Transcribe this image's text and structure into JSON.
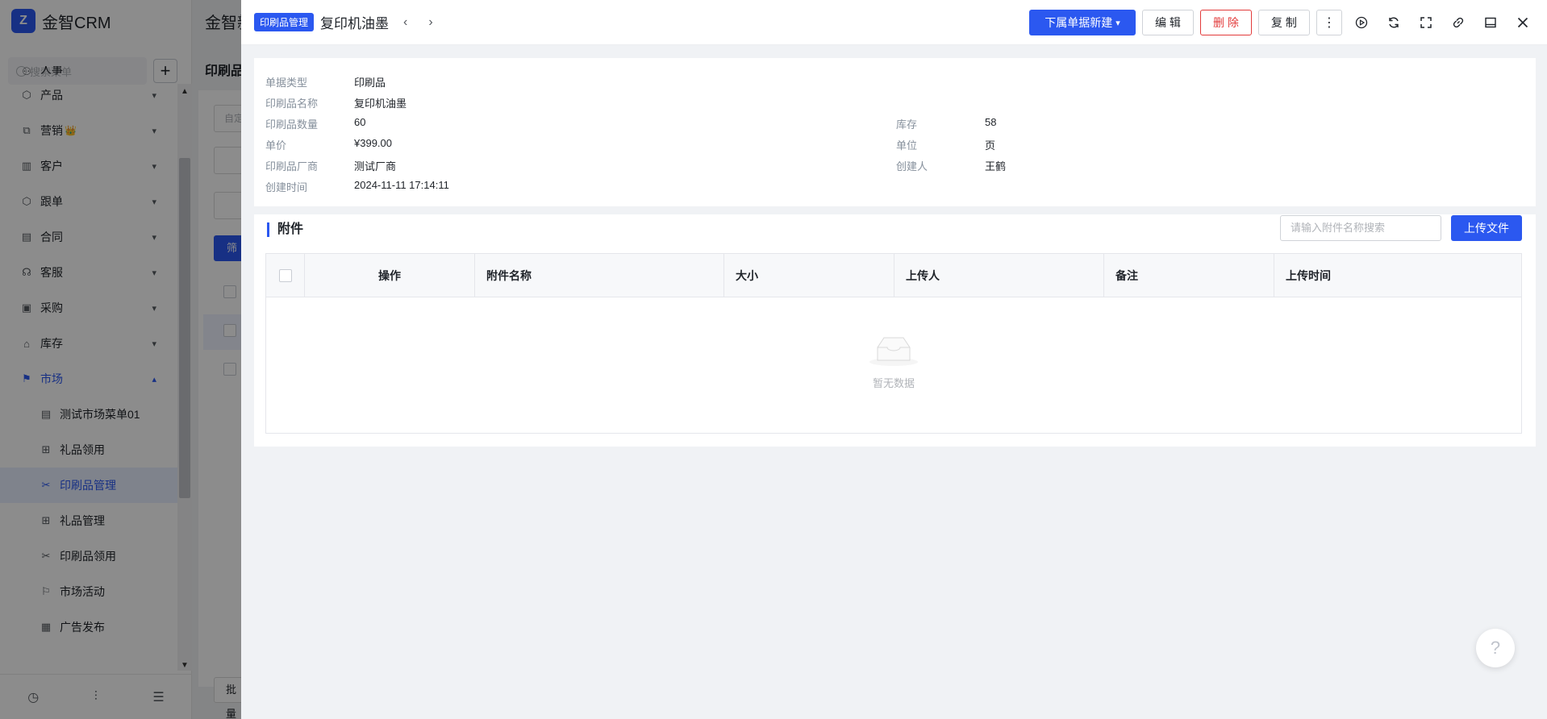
{
  "app": {
    "logo_glyph": "Z",
    "name": "金智CRM",
    "search_placeholder": "搜索菜单",
    "add_symbol": "+"
  },
  "sidebar": {
    "partial_top_item": "人事",
    "groups": [
      {
        "label": "产品",
        "icon": "product-icon"
      },
      {
        "label": "营销",
        "icon": "marketing-icon",
        "crown": "👑"
      },
      {
        "label": "客户",
        "icon": "customer-icon"
      },
      {
        "label": "跟单",
        "icon": "follow-icon"
      },
      {
        "label": "合同",
        "icon": "contract-icon"
      },
      {
        "label": "客服",
        "icon": "service-icon"
      },
      {
        "label": "采购",
        "icon": "purchase-icon"
      },
      {
        "label": "库存",
        "icon": "stock-icon"
      }
    ],
    "active_group": {
      "label": "市场",
      "icon": "market-icon"
    },
    "sub_items": [
      {
        "label": "测试市场菜单01",
        "icon": "doc-icon"
      },
      {
        "label": "礼品领用",
        "icon": "gift-icon"
      },
      {
        "label": "印刷品管理",
        "icon": "print-icon",
        "active": true
      },
      {
        "label": "礼品管理",
        "icon": "gift-icon"
      },
      {
        "label": "印刷品领用",
        "icon": "print-icon"
      },
      {
        "label": "市场活动",
        "icon": "flag-icon"
      },
      {
        "label": "广告发布",
        "icon": "ad-icon"
      }
    ]
  },
  "background_page": {
    "title": "金智新",
    "subtitle": "印刷品",
    "filter_btn": "筛",
    "input_placeholder": "自定",
    "bottom_btn": "批量"
  },
  "drawer": {
    "tag": "印刷品管理",
    "title": "复印机油墨",
    "prev_arrow": "‹",
    "next_arrow": "›",
    "actions": {
      "new_sub": "下属单据新建",
      "edit": "编 辑",
      "delete": "删 除",
      "copy": "复 制",
      "more": "⋮"
    }
  },
  "record": {
    "doc_type_label": "单据类型",
    "doc_type_value": "印刷品",
    "name_label": "印刷品名称",
    "name_value": "复印机油墨",
    "qty_label": "印刷品数量",
    "qty_value": "60",
    "stock_label": "库存",
    "stock_value": "58",
    "price_label": "单价",
    "price_value": "¥399.00",
    "unit_label": "单位",
    "unit_value": "页",
    "vendor_label": "印刷品厂商",
    "vendor_value": "测试厂商",
    "creator_label": "创建人",
    "creator_value": "王鹤",
    "created_label": "创建时间",
    "created_value": "2024-11-11 17:14:11"
  },
  "attachments": {
    "title": "附件",
    "search_placeholder": "请输入附件名称搜索",
    "upload_label": "上传文件",
    "columns": [
      "操作",
      "附件名称",
      "大小",
      "上传人",
      "备注",
      "上传时间"
    ],
    "rows": [],
    "empty_text": "暂无数据"
  },
  "help": {
    "symbol": "?"
  },
  "colors": {
    "primary": "#2b58f0",
    "danger": "#e23b3b",
    "overlay": "rgba(0,0,0,0.45)"
  }
}
